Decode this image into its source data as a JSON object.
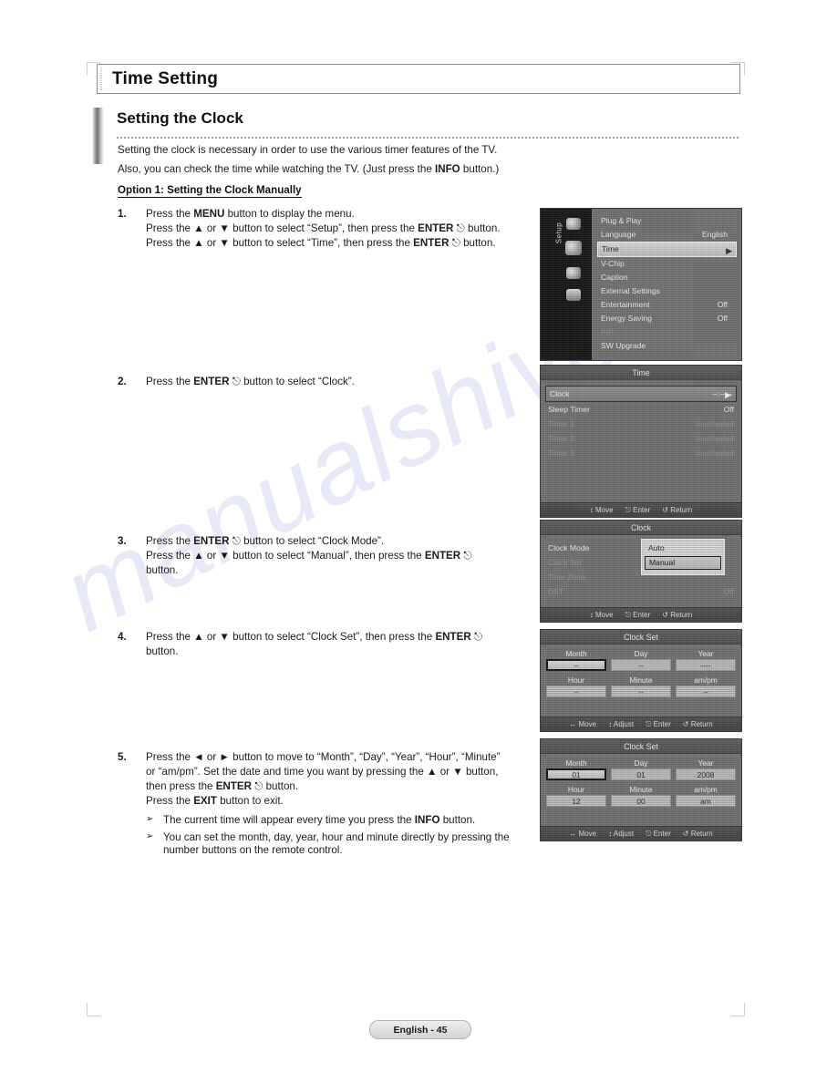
{
  "document": {
    "title": "Time Setting",
    "section_heading": "Setting the Clock",
    "intro_line1": "Setting the clock is necessary in order to use the various timer features of the TV.",
    "intro_line2_a": "Also, you can check the time while watching the TV. (Just press the ",
    "intro_line2_b": "INFO",
    "intro_line2_c": " button.)",
    "option_heading": "Option 1: Setting the Clock Manually",
    "footer": "English - 45",
    "watermark": "manualshive"
  },
  "steps": [
    {
      "number": "1.",
      "lines": [
        {
          "parts": [
            {
              "t": "Press the ",
              "b": false
            },
            {
              "t": "MENU",
              "b": true
            },
            {
              "t": " button to display the menu.",
              "b": false
            }
          ]
        },
        {
          "parts": [
            {
              "t": "Press the ▲ or ▼ button to select “Setup”, then press the ",
              "b": false
            },
            {
              "t": "ENTER",
              "b": true
            },
            {
              "t": " ⎋ button.",
              "b": false
            }
          ]
        },
        {
          "parts": [
            {
              "t": "Press the ▲ or ▼ button to select “Time”, then press the ",
              "b": false
            },
            {
              "t": "ENTER",
              "b": true
            },
            {
              "t": " ⎋ button.",
              "b": false
            }
          ]
        }
      ]
    },
    {
      "number": "2.",
      "lines": [
        {
          "parts": [
            {
              "t": "Press the ",
              "b": false
            },
            {
              "t": "ENTER",
              "b": true
            },
            {
              "t": " ⎋ button to select “Clock”.",
              "b": false
            }
          ]
        }
      ]
    },
    {
      "number": "3.",
      "lines": [
        {
          "parts": [
            {
              "t": "Press the ",
              "b": false
            },
            {
              "t": "ENTER",
              "b": true
            },
            {
              "t": " ⎋ button to select “Clock Mode”.",
              "b": false
            }
          ]
        },
        {
          "parts": [
            {
              "t": "Press the ▲ or ▼ button to select “Manual”, then press the ",
              "b": false
            },
            {
              "t": "ENTER",
              "b": true
            },
            {
              "t": " ⎋",
              "b": false
            }
          ]
        },
        {
          "parts": [
            {
              "t": "button.",
              "b": false
            }
          ]
        }
      ]
    },
    {
      "number": "4.",
      "lines": [
        {
          "parts": [
            {
              "t": "Press the ▲ or ▼ button to select “Clock Set”, then press the ",
              "b": false
            },
            {
              "t": "ENTER",
              "b": true
            },
            {
              "t": " ⎋",
              "b": false
            }
          ]
        },
        {
          "parts": [
            {
              "t": "button.",
              "b": false
            }
          ]
        }
      ]
    },
    {
      "number": "5.",
      "lines": [
        {
          "parts": [
            {
              "t": "Press the ◄ or ► button to move to “Month”, “Day”, “Year”, “Hour”, “Minute”",
              "b": false
            }
          ]
        },
        {
          "parts": [
            {
              "t": "or “am/pm”. Set the date and time you want by pressing the ▲ or ▼ button,",
              "b": false
            }
          ]
        },
        {
          "parts": [
            {
              "t": "then press the ",
              "b": false
            },
            {
              "t": "ENTER",
              "b": true
            },
            {
              "t": " ⎋ button.",
              "b": false
            }
          ]
        },
        {
          "parts": [
            {
              "t": "Press the ",
              "b": false
            },
            {
              "t": "EXIT",
              "b": true
            },
            {
              "t": " button to exit.",
              "b": false
            }
          ]
        }
      ],
      "bullets": [
        {
          "parts": [
            {
              "t": "The current time will appear every time you press the ",
              "b": false
            },
            {
              "t": "INFO",
              "b": true
            },
            {
              "t": " button.",
              "b": false
            }
          ]
        },
        {
          "parts": [
            {
              "t": "You can set the month, day, year, hour and minute directly by pressing the number buttons on the remote control.",
              "b": false
            }
          ]
        }
      ]
    }
  ],
  "osd": {
    "setup_menu": {
      "rail_label": "Setup",
      "items": [
        {
          "label": "Plug & Play",
          "value": "",
          "state": "normal"
        },
        {
          "label": "Language",
          "value": "English",
          "state": "normal"
        },
        {
          "label": "Time",
          "value": "",
          "state": "selected"
        },
        {
          "label": "V-Chip",
          "value": "",
          "state": "normal"
        },
        {
          "label": "Caption",
          "value": "",
          "state": "normal"
        },
        {
          "label": "External Settings",
          "value": "",
          "state": "normal"
        },
        {
          "label": "Entertainment",
          "value": "Off",
          "state": "normal"
        },
        {
          "label": "Energy Saving",
          "value": "Off",
          "state": "normal"
        },
        {
          "label": "PIP",
          "value": "",
          "state": "dim"
        },
        {
          "label": "SW Upgrade",
          "value": "",
          "state": "normal"
        }
      ]
    },
    "time_menu": {
      "title": "Time",
      "items": [
        {
          "label": "Clock",
          "value": "--:-- --",
          "state": "highlight"
        },
        {
          "label": "Sleep Timer",
          "value": "Off",
          "state": "normal"
        },
        {
          "label": "Timer 1",
          "value": "Inactivated",
          "state": "dim"
        },
        {
          "label": "Timer 2",
          "value": "Inactivated",
          "state": "dim"
        },
        {
          "label": "Timer 3",
          "value": "Inactivated",
          "state": "dim"
        }
      ],
      "footer": [
        "↕ Move",
        "⎋ Enter",
        "↺ Return"
      ]
    },
    "clock_menu": {
      "title": "Clock",
      "items": [
        {
          "label": "Clock Mode",
          "value": "",
          "state": "normal"
        },
        {
          "label": "Clock Set",
          "value": "",
          "state": "dim"
        },
        {
          "label": "Time Zone",
          "value": "",
          "state": "dim"
        },
        {
          "label": "DST",
          "value": "Off",
          "state": "dim"
        }
      ],
      "dropdown": {
        "options": [
          "Auto",
          "Manual"
        ],
        "selected": "Manual"
      },
      "footer": [
        "↕ Move",
        "⎋ Enter",
        "↺ Return"
      ]
    },
    "clock_set_empty": {
      "title": "Clock Set",
      "fields": [
        {
          "caption": "Month",
          "value": "--",
          "focused": true
        },
        {
          "caption": "Day",
          "value": "--",
          "focused": false
        },
        {
          "caption": "Year",
          "value": "----",
          "focused": false
        },
        {
          "caption": "Hour",
          "value": "--",
          "focused": false
        },
        {
          "caption": "Minute",
          "value": "--",
          "focused": false
        },
        {
          "caption": "am/pm",
          "value": "--",
          "focused": false
        }
      ],
      "footer": [
        "↔ Move",
        "↕ Adjust",
        "⎋ Enter",
        "↺ Return"
      ]
    },
    "clock_set_filled": {
      "title": "Clock Set",
      "fields": [
        {
          "caption": "Month",
          "value": "01",
          "focused": true
        },
        {
          "caption": "Day",
          "value": "01",
          "focused": false
        },
        {
          "caption": "Year",
          "value": "2008",
          "focused": false
        },
        {
          "caption": "Hour",
          "value": "12",
          "focused": false
        },
        {
          "caption": "Minute",
          "value": "00",
          "focused": false
        },
        {
          "caption": "am/pm",
          "value": "am",
          "focused": false
        }
      ],
      "footer": [
        "↔ Move",
        "↕ Adjust",
        "⎋ Enter",
        "↺ Return"
      ]
    }
  }
}
